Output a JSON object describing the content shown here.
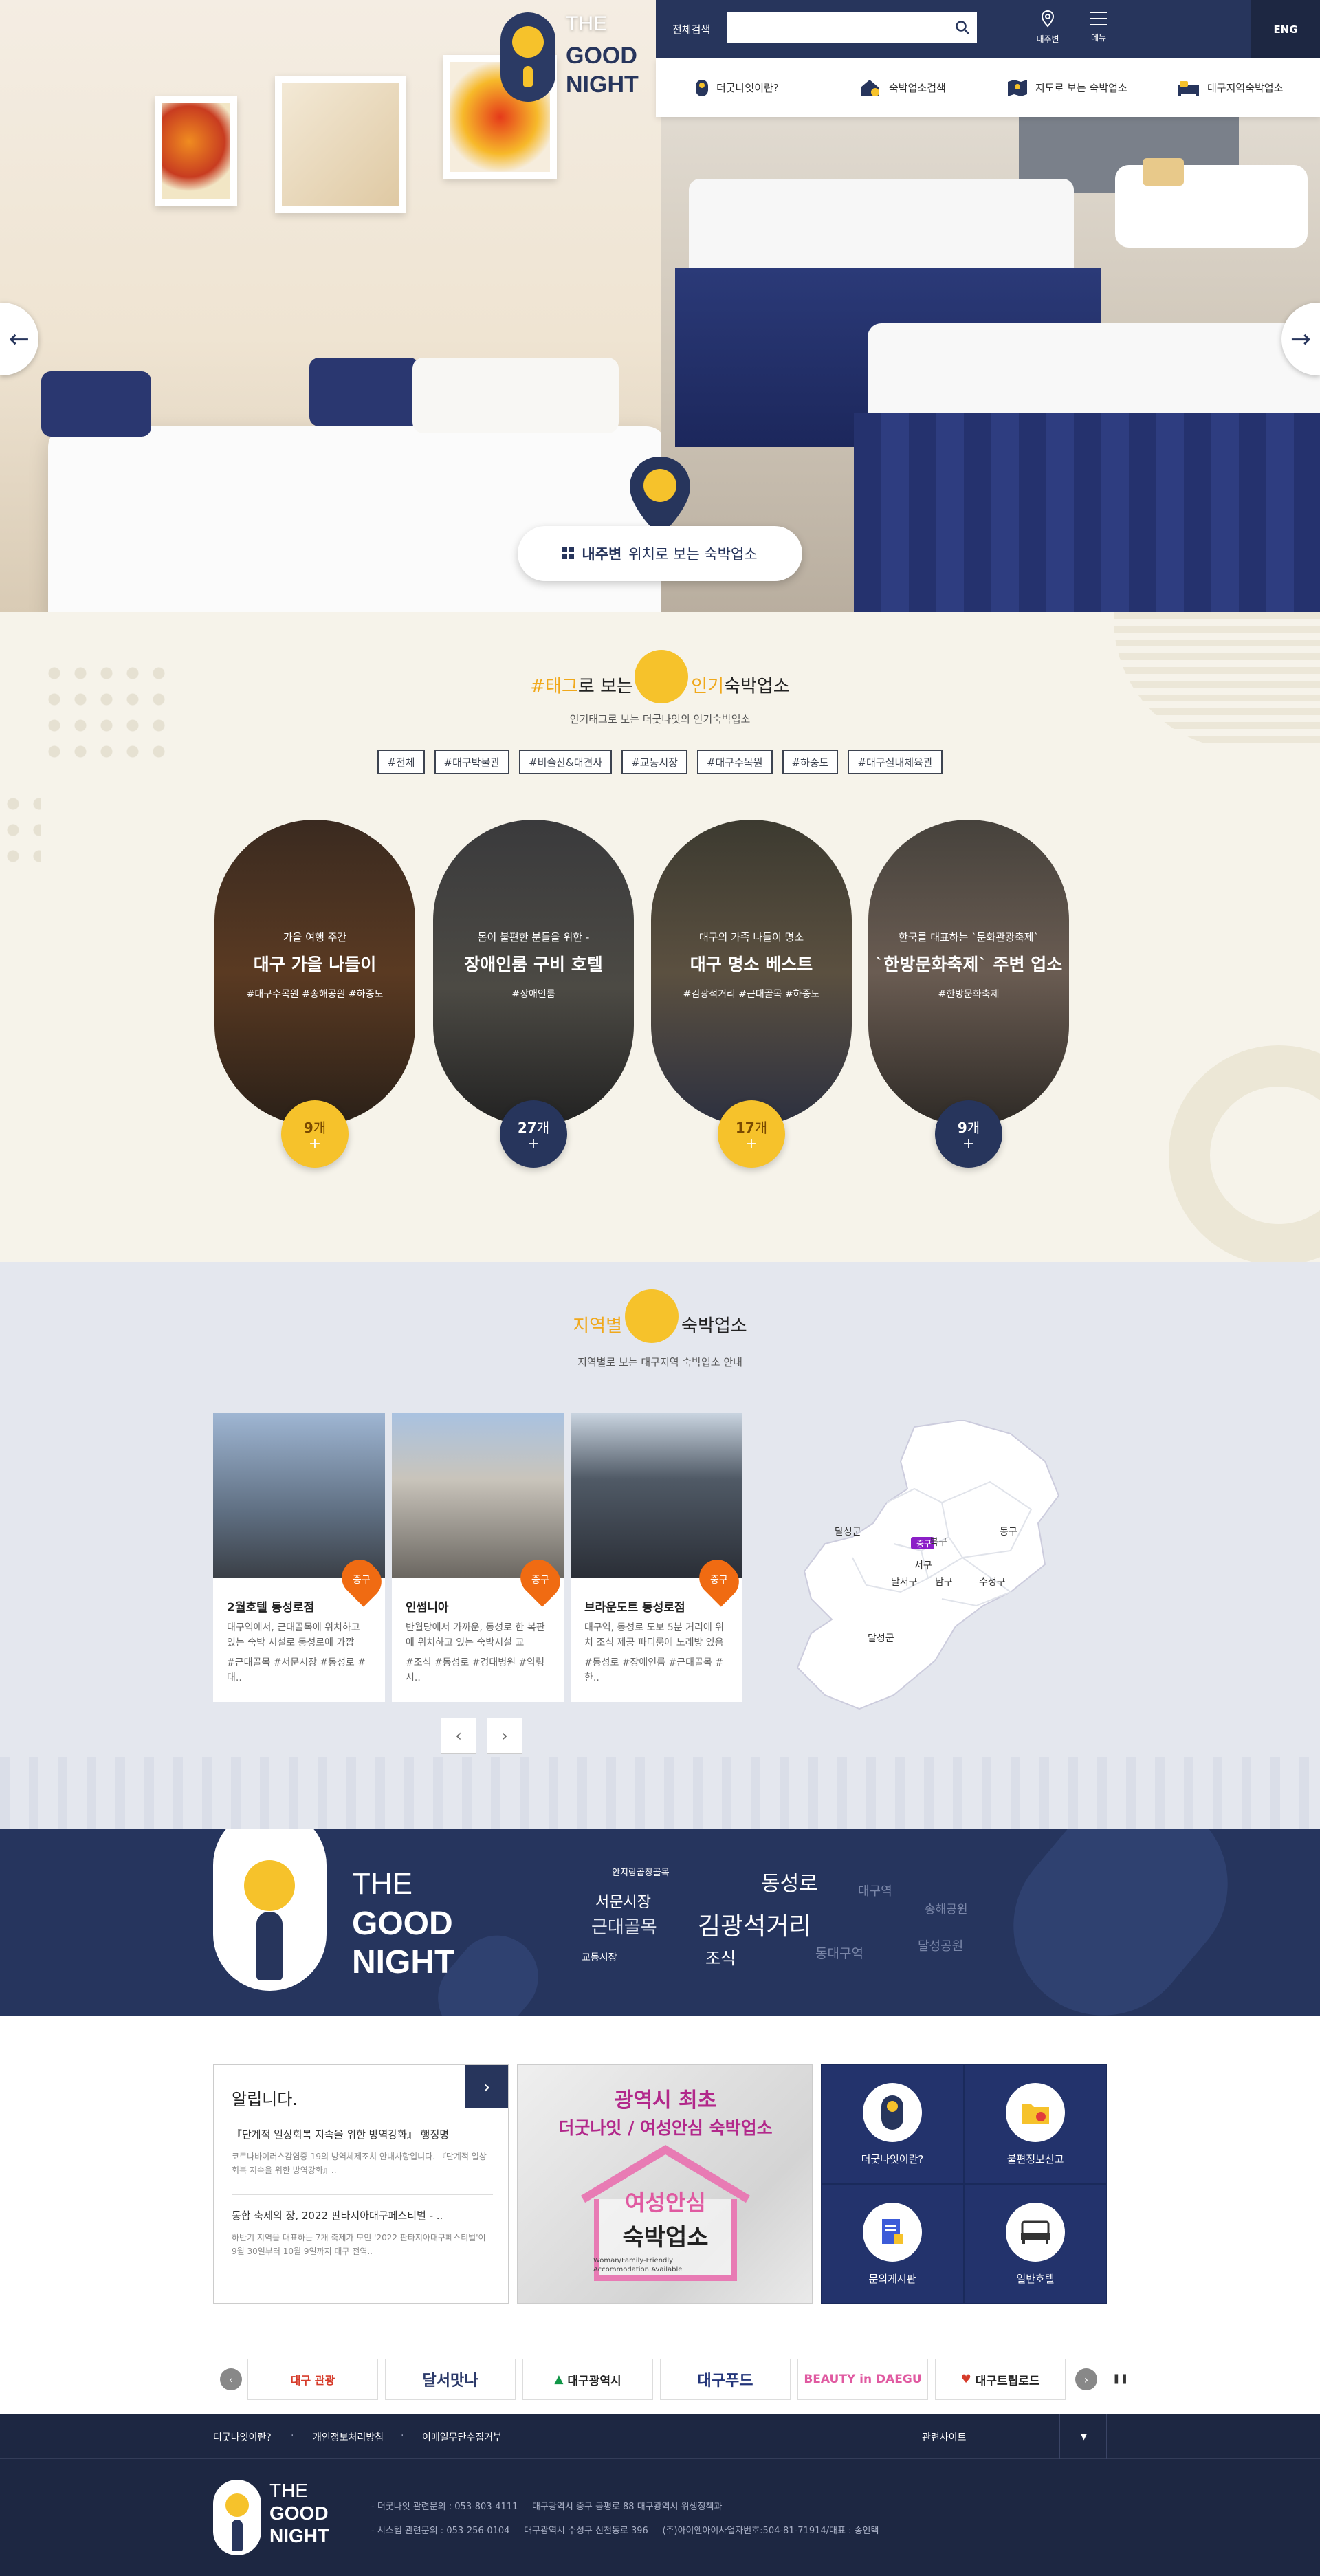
{
  "header": {
    "logo": {
      "the": "THE",
      "good": "GOOD",
      "night": "NIGHT"
    },
    "search_label": "전체검색",
    "search_value": "",
    "my_area": "내주변",
    "menu": "메뉴",
    "lang": "ENG",
    "nav": [
      "더굿나잇이란?",
      "숙박업소검색",
      "지도로 보는 숙박업소",
      "대구지역숙박업소"
    ]
  },
  "hero": {
    "map_btn_strong": "내주변",
    "map_btn_text": "위치로 보는 숙박업소"
  },
  "tags": {
    "title_pre": "#태그",
    "title_mid": "로 보는 ",
    "title_y": "인기",
    "title_post": "숙박업소",
    "subtitle": "인기태그로 보는 더굿나잇의 인기숙박업소",
    "items": [
      "#전체",
      "#대구박물관",
      "#비슬산&대견사",
      "#교동시장",
      "#대구수목원",
      "#하중도",
      "#대구실내체육관"
    ],
    "cards": [
      {
        "pre": "가을 여행 주간",
        "title": "대구 가을 나들이",
        "tags": "#대구수목원 #송해공원 #하중도",
        "count": "9",
        "unit": "개"
      },
      {
        "pre": "몸이 불편한 분들을 위한 -",
        "title": "장애인룸 구비 호텔",
        "tags": "#장애인룸",
        "count": "27",
        "unit": "개"
      },
      {
        "pre": "대구의 가족 나들이 명소",
        "title": "대구 명소 베스트",
        "tags": "#김광석거리 #근대골목 #하중도",
        "count": "17",
        "unit": "개"
      },
      {
        "pre": "한국를 대표하는 `문화관광축제`",
        "title": "`한방문화축제` 주변 업소",
        "tags": "#한방문화축제",
        "count": "9",
        "unit": "개"
      }
    ]
  },
  "region": {
    "title_y": "지역별",
    "title_post": "숙박업소",
    "subtitle": "지역별로 보는 대구지역 숙박업소 안내",
    "cards": [
      {
        "badge": "중구",
        "name": "2월호텔 동성로점",
        "desc": "대구역에서, 근대골목에 위치하고 있는 숙박 시설로 동성로에 가깝",
        "tags": "#근대골목 #서문시장 #동성로 #대.."
      },
      {
        "badge": "중구",
        "name": "인썸니아",
        "desc": "반월당에서 가까운, 동성로 한 복판에 위치하고 있는 숙박시설 교",
        "tags": "#조식 #동성로 #경대병원 #약령시.."
      },
      {
        "badge": "중구",
        "name": "브라운도트 동성로점",
        "desc": "대구역, 동성로 도보 5분 거리에 위치 조식 제공 파티룸에 노래방 있음",
        "tags": "#동성로 #장애인룸 #근대골목 #한.."
      }
    ],
    "map": {
      "districts": [
        "북구",
        "동구",
        "달성군",
        "서구",
        "중구",
        "달서구",
        "남구",
        "수성구",
        "달성군"
      ]
    }
  },
  "brand": {
    "the": "THE",
    "good": "GOOD",
    "night": "NIGHT",
    "keywords": [
      "안지랑곱창골목",
      "동성로",
      "대구역",
      "서문시장",
      "송해공원",
      "근대골목",
      "김광석거리",
      "교동시장",
      "조식",
      "동대구역",
      "달성공원"
    ]
  },
  "notice": {
    "title": "알립니다.",
    "items": [
      {
        "title": "『단계적 일상회복 지속을 위한 방역강화』 행정명",
        "body": "코로나바이러스감염증-19의 방역체제조치 안내사항입니다. 『단계적 일상회복 지속을 위한 방역강화』.."
      },
      {
        "title": "동합 축제의 장, 2022 판타지아대구페스티벌 - ..",
        "body": "하반기 지역을 대표하는 7개 축제가 모인 '2022 판타지아대구페스티벌'이 9월 30일부터 10월 9일까지 대구 전역.."
      }
    ]
  },
  "promo": {
    "l1": "광역시 최초",
    "l2": "더굿나잇 / 여성안심 숙박업소",
    "house_l1": "여성안심",
    "house_l2": "숙박업소",
    "en": "Woman/Family-Friendly Accommodation Available"
  },
  "quick": [
    "더굿나잇이란?",
    "불편정보신고",
    "문의게시판",
    "일반호텔"
  ],
  "logos": [
    "대구 관광",
    "달서맛나",
    "대구광역시",
    "대구푸드",
    "BEAUTY in DAEGU",
    "대구트립로드"
  ],
  "footer": {
    "links": [
      "더굿나잇이란?",
      "개인정보처리방침",
      "이메일무단수집거부"
    ],
    "related": "관련사이트",
    "line1": "- 더굿나잇 관련문의 : 053-803-4111     대구광역시 중구 공평로 88 대구광역시 위생정책과",
    "line2": "- 시스템 관련문의 : 053-256-0104     대구광역시 수성구 신천동로 396     (주)아이엔아이사업자번호:504-81-71914/대표 : 송인택"
  },
  "colors": {
    "navy": "#27355c",
    "yellow": "#f6c22b",
    "orange": "#f06b12"
  }
}
